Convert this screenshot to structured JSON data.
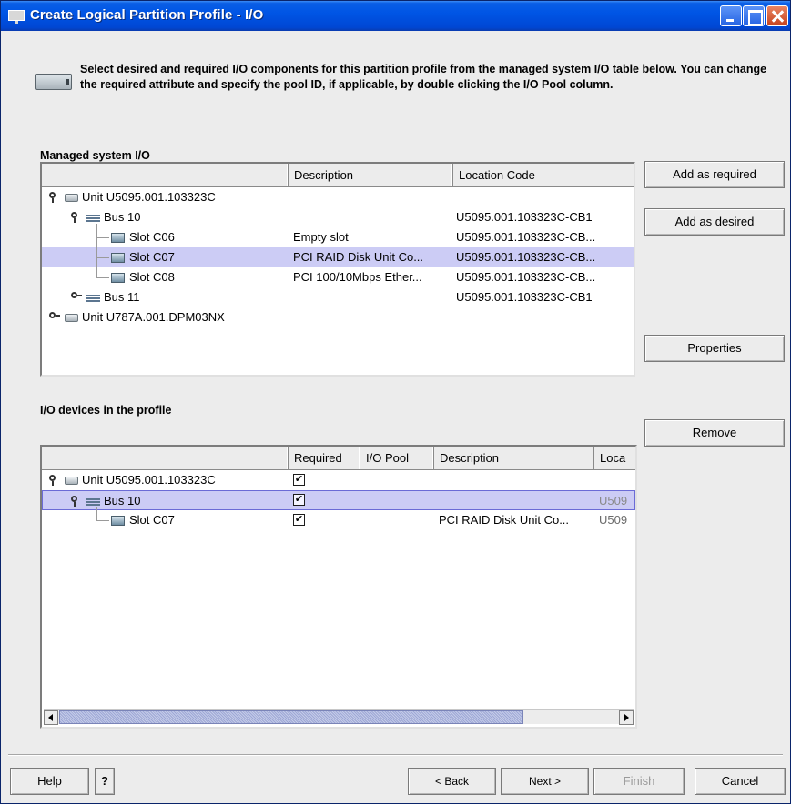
{
  "window": {
    "title": "Create Logical Partition Profile - I/O"
  },
  "intro": {
    "text": "Select desired and required I/O components for this partition profile from the managed system I/O table below. You can change the required attribute and specify the pool ID, if applicable, by double clicking the I/O Pool column."
  },
  "managed": {
    "label": "Managed system I/O",
    "columns": [
      "",
      "Description",
      "Location Code"
    ],
    "rows": [
      {
        "name": "Unit U5095.001.103323C",
        "description": "",
        "location": "",
        "kind": "unit",
        "state": "open"
      },
      {
        "name": "Bus 10",
        "description": "",
        "location": "U5095.001.103323C-CB1",
        "kind": "bus",
        "state": "open"
      },
      {
        "name": "Slot C06",
        "description": "Empty slot",
        "location": "U5095.001.103323C-CB...",
        "kind": "slot"
      },
      {
        "name": "Slot C07",
        "description": "PCI RAID Disk Unit Co...",
        "location": "U5095.001.103323C-CB...",
        "kind": "slot",
        "selected": true
      },
      {
        "name": "Slot C08",
        "description": "PCI 100/10Mbps Ether...",
        "location": "U5095.001.103323C-CB...",
        "kind": "slot"
      },
      {
        "name": "Bus 11",
        "description": "",
        "location": "U5095.001.103323C-CB1",
        "kind": "bus",
        "state": "closed"
      },
      {
        "name": "Unit U787A.001.DPM03NX",
        "description": "",
        "location": "",
        "kind": "unit",
        "state": "closed"
      }
    ]
  },
  "profile": {
    "label": "I/O devices in the profile",
    "columns": [
      "",
      "Required",
      "I/O Pool",
      "Description",
      "Loca"
    ],
    "rows": [
      {
        "name": "Unit U5095.001.103323C",
        "required": "✔",
        "pool": "",
        "description": "",
        "location": "",
        "kind": "unit"
      },
      {
        "name": "Bus 10",
        "required": "✔",
        "pool": "",
        "description": "",
        "location": "U509",
        "kind": "bus",
        "selected": true
      },
      {
        "name": "Slot C07",
        "required": "✔",
        "pool": "",
        "description": "PCI RAID Disk Unit Co...",
        "location": "U509",
        "kind": "slot"
      }
    ],
    "scroll_position": 0
  },
  "side_buttons": {
    "add_required": "Add as required",
    "add_desired": "Add as desired",
    "properties": "Properties",
    "remove": "Remove"
  },
  "footer": {
    "help": "Help",
    "question": "?",
    "back": "< Back",
    "next": "Next >",
    "finish": "Finish",
    "cancel": "Cancel"
  },
  "colors": {
    "titlebar": "#0055e5",
    "selection": "#ccccf5"
  }
}
